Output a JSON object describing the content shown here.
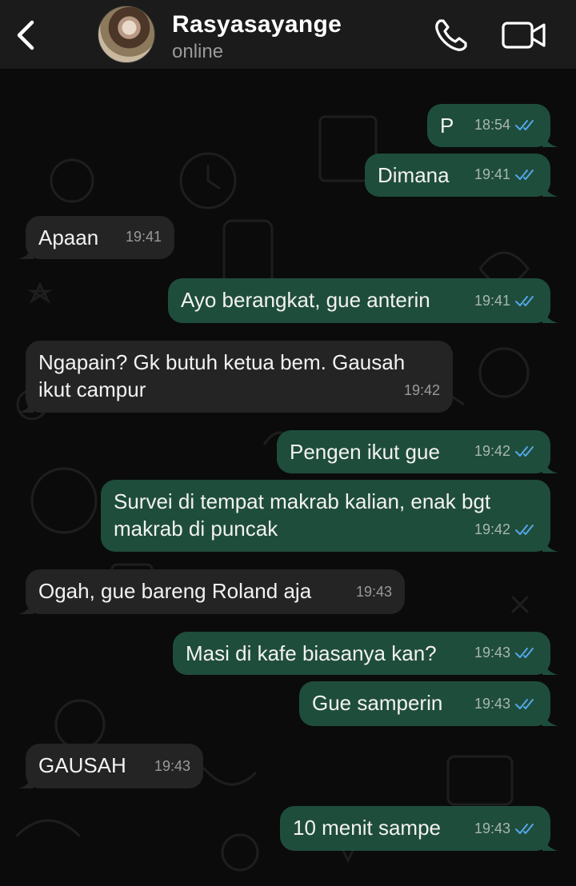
{
  "header": {
    "contact_name": "Rasyasayange",
    "status": "online",
    "icons": {
      "back": "chevron-left-icon",
      "call": "phone-icon",
      "video": "video-camera-icon"
    }
  },
  "colors": {
    "header_bg": "#1b1b1b",
    "chat_bg": "#0b0b0b",
    "outgoing_bubble": "#1f4d3b",
    "incoming_bubble": "#242424",
    "read_tick": "#53a7e8"
  },
  "messages": [
    {
      "dir": "out",
      "text": "P",
      "time": "18:54",
      "read": true
    },
    {
      "dir": "out",
      "text": "Dimana",
      "time": "19:41",
      "read": true
    },
    {
      "dir": "in",
      "text": "Apaan",
      "time": "19:41"
    },
    {
      "dir": "out",
      "text": "Ayo berangkat, gue anterin",
      "time": "19:41",
      "read": true
    },
    {
      "dir": "in",
      "text": "Ngapain? Gk butuh ketua bem. Gausah ikut campur",
      "time": "19:42"
    },
    {
      "dir": "out",
      "text": "Pengen ikut gue",
      "time": "19:42",
      "read": true
    },
    {
      "dir": "out",
      "text": "Survei di tempat makrab kalian, enak bgt makrab di puncak",
      "time": "19:42",
      "read": true
    },
    {
      "dir": "in",
      "text": "Ogah, gue bareng Roland aja",
      "time": "19:43"
    },
    {
      "dir": "out",
      "text": "Masi di kafe biasanya kan?",
      "time": "19:43",
      "read": true
    },
    {
      "dir": "out",
      "text": "Gue samperin",
      "time": "19:43",
      "read": true
    },
    {
      "dir": "in",
      "text": "GAUSAH",
      "time": "19:43"
    },
    {
      "dir": "out",
      "text": "10 menit sampe",
      "time": "19:43",
      "read": true
    }
  ]
}
